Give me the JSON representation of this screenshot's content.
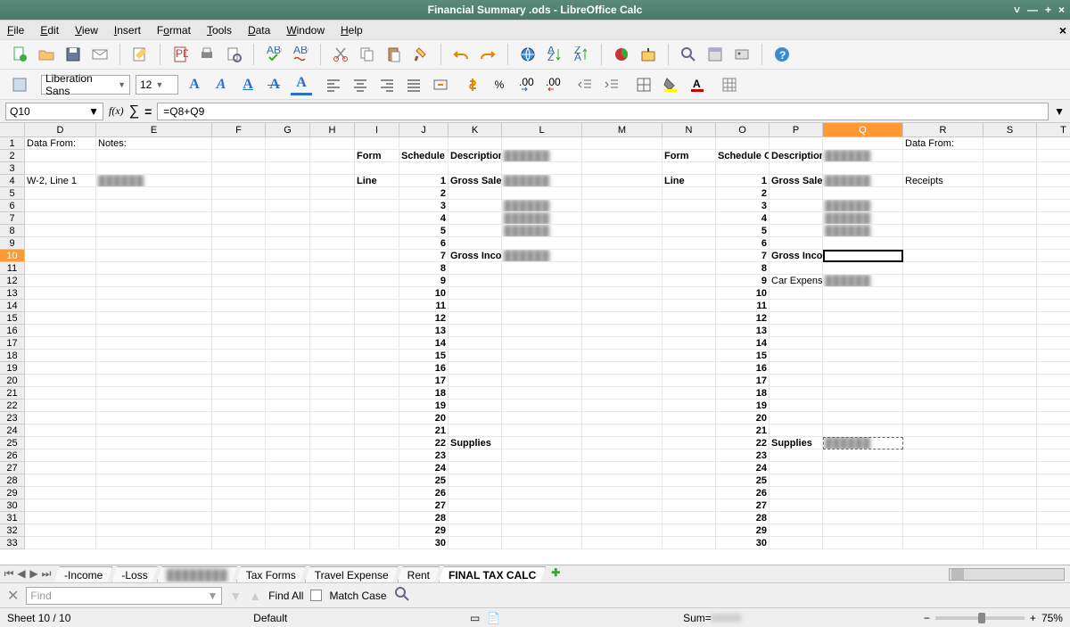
{
  "window": {
    "title": "Financial Summary .ods - LibreOffice Calc"
  },
  "menu": [
    "File",
    "Edit",
    "View",
    "Insert",
    "Format",
    "Tools",
    "Data",
    "Window",
    "Help"
  ],
  "font": {
    "name": "Liberation Sans",
    "size": "12"
  },
  "formula": {
    "ref": "Q10",
    "value": "=Q8+Q9"
  },
  "columns": [
    "D",
    "E",
    "F",
    "G",
    "H",
    "I",
    "J",
    "K",
    "L",
    "M",
    "N",
    "O",
    "P",
    "Q",
    "R",
    "S",
    "T"
  ],
  "row_count": 33,
  "selected_row": "10",
  "selected_col": "Q",
  "cells": {
    "r1": {
      "D": "Data From:",
      "E": "Notes:",
      "R": "Data From:"
    },
    "r2": {
      "I": "Form",
      "J": "Schedule C",
      "K": "Description",
      "N": "Form",
      "O": "Schedule C",
      "P": "Description"
    },
    "r4": {
      "D": "W-2, Line 1",
      "I": "Line",
      "J": "1",
      "K": "Gross Sales",
      "N": "Line",
      "O": "1",
      "P": "Gross Sales",
      "R": "Receipts"
    },
    "r5": {
      "J": "2",
      "O": "2"
    },
    "r6": {
      "J": "3",
      "O": "3"
    },
    "r7": {
      "J": "4",
      "O": "4"
    },
    "r8": {
      "J": "5",
      "O": "5"
    },
    "r9": {
      "J": "6",
      "O": "6"
    },
    "r10": {
      "J": "7",
      "K": "Gross Income",
      "O": "7",
      "P": "Gross Income"
    },
    "r11": {
      "J": "8",
      "O": "8"
    },
    "r12": {
      "J": "9",
      "O": "9",
      "P": "Car Expense"
    },
    "r13": {
      "J": "10",
      "O": "10"
    },
    "r14": {
      "J": "11",
      "O": "11"
    },
    "r15": {
      "J": "12",
      "O": "12"
    },
    "r16": {
      "J": "13",
      "O": "13"
    },
    "r17": {
      "J": "14",
      "O": "14"
    },
    "r18": {
      "J": "15",
      "O": "15"
    },
    "r19": {
      "J": "16",
      "O": "16"
    },
    "r20": {
      "J": "17",
      "O": "17"
    },
    "r21": {
      "J": "18",
      "O": "18"
    },
    "r22": {
      "J": "19",
      "O": "19"
    },
    "r23": {
      "J": "20",
      "O": "20"
    },
    "r24": {
      "J": "21",
      "O": "21"
    },
    "r25": {
      "J": "22",
      "K": "Supplies",
      "O": "22",
      "P": "Supplies"
    },
    "r26": {
      "J": "23",
      "O": "23"
    },
    "r27": {
      "J": "24",
      "O": "24"
    },
    "r28": {
      "J": "25",
      "O": "25"
    },
    "r29": {
      "J": "26",
      "O": "26"
    },
    "r30": {
      "J": "27",
      "O": "27"
    },
    "r31": {
      "J": "28",
      "O": "28"
    },
    "r32": {
      "J": "29",
      "O": "29"
    },
    "r33": {
      "J": "30",
      "O": "30"
    }
  },
  "bold_cells": [
    "r2.I",
    "r2.J",
    "r2.K",
    "r2.N",
    "r2.O",
    "r2.P",
    "r4.I",
    "r4.J",
    "r4.K",
    "r4.N",
    "r4.O",
    "r4.P",
    "r5.J",
    "r5.O",
    "r6.J",
    "r6.O",
    "r7.J",
    "r7.O",
    "r8.J",
    "r8.O",
    "r9.J",
    "r9.O",
    "r10.J",
    "r10.K",
    "r10.O",
    "r10.P",
    "r11.J",
    "r11.O",
    "r12.J",
    "r12.O",
    "r13.J",
    "r13.O",
    "r14.J",
    "r14.O",
    "r15.J",
    "r15.O",
    "r16.J",
    "r16.O",
    "r17.J",
    "r17.O",
    "r18.J",
    "r18.O",
    "r19.J",
    "r19.O",
    "r20.J",
    "r20.O",
    "r21.J",
    "r21.O",
    "r22.J",
    "r22.O",
    "r23.J",
    "r23.O",
    "r24.J",
    "r24.O",
    "r25.J",
    "r25.K",
    "r25.O",
    "r25.P",
    "r26.J",
    "r26.O",
    "r27.J",
    "r27.O",
    "r28.J",
    "r28.O",
    "r29.J",
    "r29.O",
    "r30.J",
    "r30.O",
    "r31.J",
    "r31.O",
    "r32.J",
    "r32.O",
    "r33.J",
    "r33.O"
  ],
  "right_align": [
    "J",
    "O"
  ],
  "blur_cells": [
    "r2.L",
    "r2.Q",
    "r4.E",
    "r4.L",
    "r4.Q",
    "r6.L",
    "r6.Q",
    "r7.L",
    "r7.Q",
    "r8.L",
    "r8.Q",
    "r10.L",
    "r12.Q",
    "r25.Q"
  ],
  "marching_cell": "r25.Q",
  "tabs": [
    "  -Income",
    "-Loss",
    "",
    "Tax Forms",
    "Travel Expense",
    "Rent",
    "FINAL TAX CALC"
  ],
  "active_tab": 6,
  "find": {
    "placeholder": "Find",
    "findall": "Find All",
    "matchcase": "Match Case"
  },
  "status": {
    "sheet": "Sheet 10 / 10",
    "style": "Default",
    "sum": "Sum=",
    "zoom": "75%"
  }
}
